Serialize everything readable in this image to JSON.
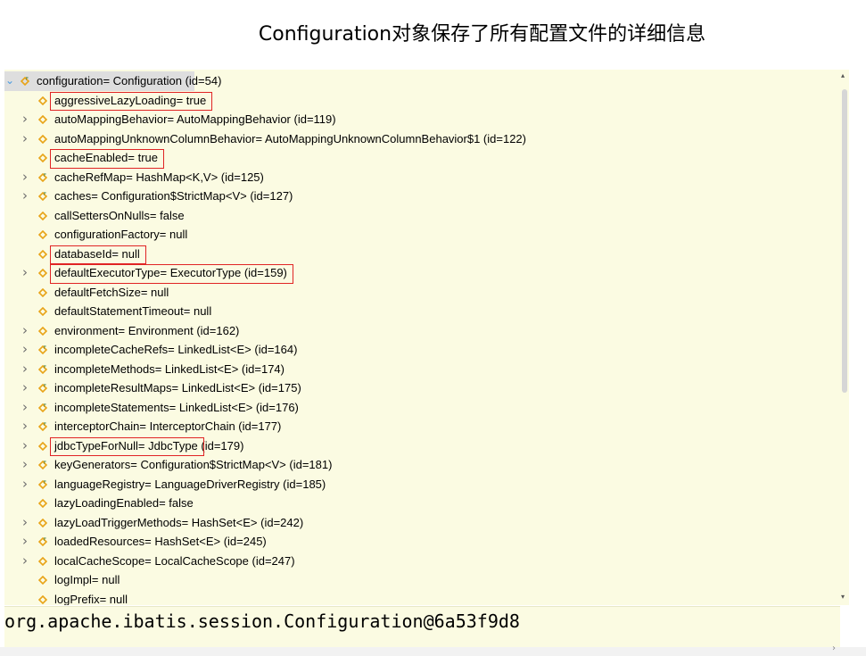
{
  "caption": "Configuration对象保存了所有配置文件的详细信息",
  "root": {
    "label": "configuration= Configuration  (id=54)"
  },
  "fields": [
    {
      "label": "aggressiveLazyLoading= true",
      "expandable": false,
      "icon": "field-icon",
      "highlighted": true
    },
    {
      "label": "autoMappingBehavior= AutoMappingBehavior  (id=119)",
      "expandable": true,
      "icon": "field-icon",
      "highlighted": false
    },
    {
      "label": "autoMappingUnknownColumnBehavior= AutoMappingUnknownColumnBehavior$1  (id=122)",
      "expandable": true,
      "icon": "field-icon",
      "highlighted": false
    },
    {
      "label": "cacheEnabled= true",
      "expandable": false,
      "icon": "field-icon",
      "highlighted": true
    },
    {
      "label": "cacheRefMap= HashMap<K,V>  (id=125)",
      "expandable": true,
      "icon": "final-field-icon",
      "highlighted": false
    },
    {
      "label": "caches= Configuration$StrictMap<V>  (id=127)",
      "expandable": true,
      "icon": "final-field-icon",
      "highlighted": false
    },
    {
      "label": "callSettersOnNulls= false",
      "expandable": false,
      "icon": "field-icon",
      "highlighted": false
    },
    {
      "label": "configurationFactory= null",
      "expandable": false,
      "icon": "field-icon",
      "highlighted": false
    },
    {
      "label": "databaseId= null",
      "expandable": false,
      "icon": "field-icon",
      "highlighted": true
    },
    {
      "label": "defaultExecutorType= ExecutorType  (id=159)",
      "expandable": true,
      "icon": "field-icon",
      "highlighted": true
    },
    {
      "label": "defaultFetchSize= null",
      "expandable": false,
      "icon": "field-icon",
      "highlighted": false
    },
    {
      "label": "defaultStatementTimeout= null",
      "expandable": false,
      "icon": "field-icon",
      "highlighted": false
    },
    {
      "label": "environment= Environment  (id=162)",
      "expandable": true,
      "icon": "field-icon",
      "highlighted": false
    },
    {
      "label": "incompleteCacheRefs= LinkedList<E>  (id=164)",
      "expandable": true,
      "icon": "final-field-icon",
      "highlighted": false
    },
    {
      "label": "incompleteMethods= LinkedList<E>  (id=174)",
      "expandable": true,
      "icon": "final-field-icon",
      "highlighted": false
    },
    {
      "label": "incompleteResultMaps= LinkedList<E>  (id=175)",
      "expandable": true,
      "icon": "final-field-icon",
      "highlighted": false
    },
    {
      "label": "incompleteStatements= LinkedList<E>  (id=176)",
      "expandable": true,
      "icon": "final-field-icon",
      "highlighted": false
    },
    {
      "label": "interceptorChain= InterceptorChain  (id=177)",
      "expandable": true,
      "icon": "final-field-icon",
      "highlighted": false
    },
    {
      "label": "jdbcTypeForNull= JdbcType  (id=179)",
      "expandable": true,
      "icon": "field-icon",
      "highlighted": true
    },
    {
      "label": "keyGenerators= Configuration$StrictMap<V>  (id=181)",
      "expandable": true,
      "icon": "final-field-icon",
      "highlighted": false
    },
    {
      "label": "languageRegistry= LanguageDriverRegistry  (id=185)",
      "expandable": true,
      "icon": "final-field-icon",
      "highlighted": false
    },
    {
      "label": "lazyLoadingEnabled= false",
      "expandable": false,
      "icon": "field-icon",
      "highlighted": false
    },
    {
      "label": "lazyLoadTriggerMethods= HashSet<E>  (id=242)",
      "expandable": true,
      "icon": "field-icon",
      "highlighted": false
    },
    {
      "label": "loadedResources= HashSet<E>  (id=245)",
      "expandable": true,
      "icon": "final-field-icon",
      "highlighted": false
    },
    {
      "label": "localCacheScope= LocalCacheScope  (id=247)",
      "expandable": true,
      "icon": "field-icon",
      "highlighted": false
    },
    {
      "label": "logImpl= null",
      "expandable": false,
      "icon": "field-icon",
      "highlighted": false
    },
    {
      "label": "logPrefix= null",
      "expandable": false,
      "icon": "field-icon",
      "highlighted": false
    }
  ],
  "detail_value": "org.apache.ibatis.session.Configuration@6a53f9d8",
  "colors": {
    "panel_bg": "#fbfbe2",
    "field_icon": "#e8a317",
    "highlight_box": "#e02424"
  }
}
